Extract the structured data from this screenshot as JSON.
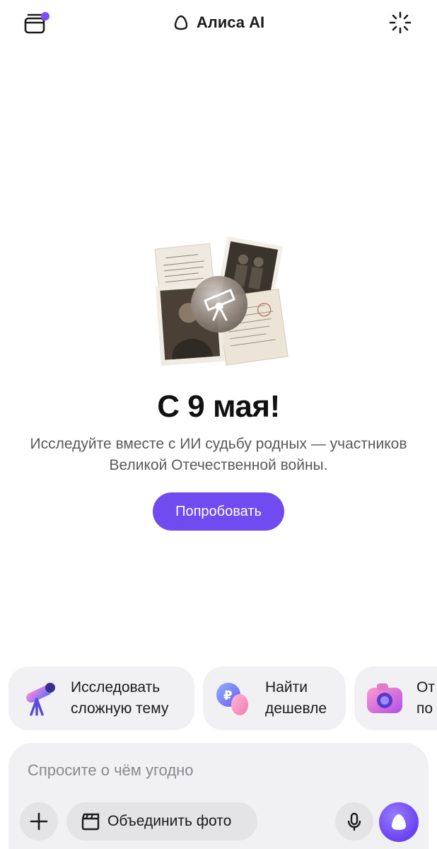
{
  "header": {
    "title": "Алиса AI",
    "left_icon": "chats-icon",
    "right_icon": "sparkle-icon",
    "notification_color": "#7b4dff"
  },
  "hero": {
    "title": "С 9 мая!",
    "text": "Исследуйте вместе с ИИ судьбу родных — участников Великой Отечественной войны.",
    "button_label": "Попробовать",
    "accent": "#6f4bf0",
    "image_icon": "telescope-icon"
  },
  "suggestions": [
    {
      "label": "Исследовать\nсложную тему",
      "icon": "telescope-icon"
    },
    {
      "label": "Найти\nдешевле",
      "icon": "coins-icon"
    },
    {
      "label": "От\nпо",
      "icon": "camera-icon"
    }
  ],
  "composer": {
    "placeholder": "Спросите о чём угодно",
    "merge_label": "Объединить фото",
    "add_icon": "plus-icon",
    "merge_icon": "clapperboard-icon",
    "mic_icon": "microphone-icon",
    "send_icon": "alice-icon"
  }
}
